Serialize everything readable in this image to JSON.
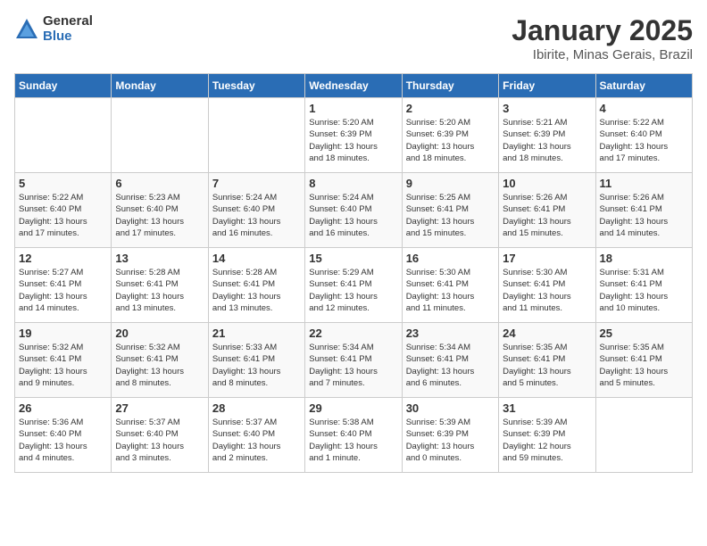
{
  "logo": {
    "general": "General",
    "blue": "Blue"
  },
  "calendar": {
    "title": "January 2025",
    "subtitle": "Ibirite, Minas Gerais, Brazil"
  },
  "days_of_week": [
    "Sunday",
    "Monday",
    "Tuesday",
    "Wednesday",
    "Thursday",
    "Friday",
    "Saturday"
  ],
  "weeks": [
    [
      {
        "day": "",
        "info": ""
      },
      {
        "day": "",
        "info": ""
      },
      {
        "day": "",
        "info": ""
      },
      {
        "day": "1",
        "info": "Sunrise: 5:20 AM\nSunset: 6:39 PM\nDaylight: 13 hours\nand 18 minutes."
      },
      {
        "day": "2",
        "info": "Sunrise: 5:20 AM\nSunset: 6:39 PM\nDaylight: 13 hours\nand 18 minutes."
      },
      {
        "day": "3",
        "info": "Sunrise: 5:21 AM\nSunset: 6:39 PM\nDaylight: 13 hours\nand 18 minutes."
      },
      {
        "day": "4",
        "info": "Sunrise: 5:22 AM\nSunset: 6:40 PM\nDaylight: 13 hours\nand 17 minutes."
      }
    ],
    [
      {
        "day": "5",
        "info": "Sunrise: 5:22 AM\nSunset: 6:40 PM\nDaylight: 13 hours\nand 17 minutes."
      },
      {
        "day": "6",
        "info": "Sunrise: 5:23 AM\nSunset: 6:40 PM\nDaylight: 13 hours\nand 17 minutes."
      },
      {
        "day": "7",
        "info": "Sunrise: 5:24 AM\nSunset: 6:40 PM\nDaylight: 13 hours\nand 16 minutes."
      },
      {
        "day": "8",
        "info": "Sunrise: 5:24 AM\nSunset: 6:40 PM\nDaylight: 13 hours\nand 16 minutes."
      },
      {
        "day": "9",
        "info": "Sunrise: 5:25 AM\nSunset: 6:41 PM\nDaylight: 13 hours\nand 15 minutes."
      },
      {
        "day": "10",
        "info": "Sunrise: 5:26 AM\nSunset: 6:41 PM\nDaylight: 13 hours\nand 15 minutes."
      },
      {
        "day": "11",
        "info": "Sunrise: 5:26 AM\nSunset: 6:41 PM\nDaylight: 13 hours\nand 14 minutes."
      }
    ],
    [
      {
        "day": "12",
        "info": "Sunrise: 5:27 AM\nSunset: 6:41 PM\nDaylight: 13 hours\nand 14 minutes."
      },
      {
        "day": "13",
        "info": "Sunrise: 5:28 AM\nSunset: 6:41 PM\nDaylight: 13 hours\nand 13 minutes."
      },
      {
        "day": "14",
        "info": "Sunrise: 5:28 AM\nSunset: 6:41 PM\nDaylight: 13 hours\nand 13 minutes."
      },
      {
        "day": "15",
        "info": "Sunrise: 5:29 AM\nSunset: 6:41 PM\nDaylight: 13 hours\nand 12 minutes."
      },
      {
        "day": "16",
        "info": "Sunrise: 5:30 AM\nSunset: 6:41 PM\nDaylight: 13 hours\nand 11 minutes."
      },
      {
        "day": "17",
        "info": "Sunrise: 5:30 AM\nSunset: 6:41 PM\nDaylight: 13 hours\nand 11 minutes."
      },
      {
        "day": "18",
        "info": "Sunrise: 5:31 AM\nSunset: 6:41 PM\nDaylight: 13 hours\nand 10 minutes."
      }
    ],
    [
      {
        "day": "19",
        "info": "Sunrise: 5:32 AM\nSunset: 6:41 PM\nDaylight: 13 hours\nand 9 minutes."
      },
      {
        "day": "20",
        "info": "Sunrise: 5:32 AM\nSunset: 6:41 PM\nDaylight: 13 hours\nand 8 minutes."
      },
      {
        "day": "21",
        "info": "Sunrise: 5:33 AM\nSunset: 6:41 PM\nDaylight: 13 hours\nand 8 minutes."
      },
      {
        "day": "22",
        "info": "Sunrise: 5:34 AM\nSunset: 6:41 PM\nDaylight: 13 hours\nand 7 minutes."
      },
      {
        "day": "23",
        "info": "Sunrise: 5:34 AM\nSunset: 6:41 PM\nDaylight: 13 hours\nand 6 minutes."
      },
      {
        "day": "24",
        "info": "Sunrise: 5:35 AM\nSunset: 6:41 PM\nDaylight: 13 hours\nand 5 minutes."
      },
      {
        "day": "25",
        "info": "Sunrise: 5:35 AM\nSunset: 6:41 PM\nDaylight: 13 hours\nand 5 minutes."
      }
    ],
    [
      {
        "day": "26",
        "info": "Sunrise: 5:36 AM\nSunset: 6:40 PM\nDaylight: 13 hours\nand 4 minutes."
      },
      {
        "day": "27",
        "info": "Sunrise: 5:37 AM\nSunset: 6:40 PM\nDaylight: 13 hours\nand 3 minutes."
      },
      {
        "day": "28",
        "info": "Sunrise: 5:37 AM\nSunset: 6:40 PM\nDaylight: 13 hours\nand 2 minutes."
      },
      {
        "day": "29",
        "info": "Sunrise: 5:38 AM\nSunset: 6:40 PM\nDaylight: 13 hours\nand 1 minute."
      },
      {
        "day": "30",
        "info": "Sunrise: 5:39 AM\nSunset: 6:39 PM\nDaylight: 13 hours\nand 0 minutes."
      },
      {
        "day": "31",
        "info": "Sunrise: 5:39 AM\nSunset: 6:39 PM\nDaylight: 12 hours\nand 59 minutes."
      },
      {
        "day": "",
        "info": ""
      }
    ]
  ]
}
